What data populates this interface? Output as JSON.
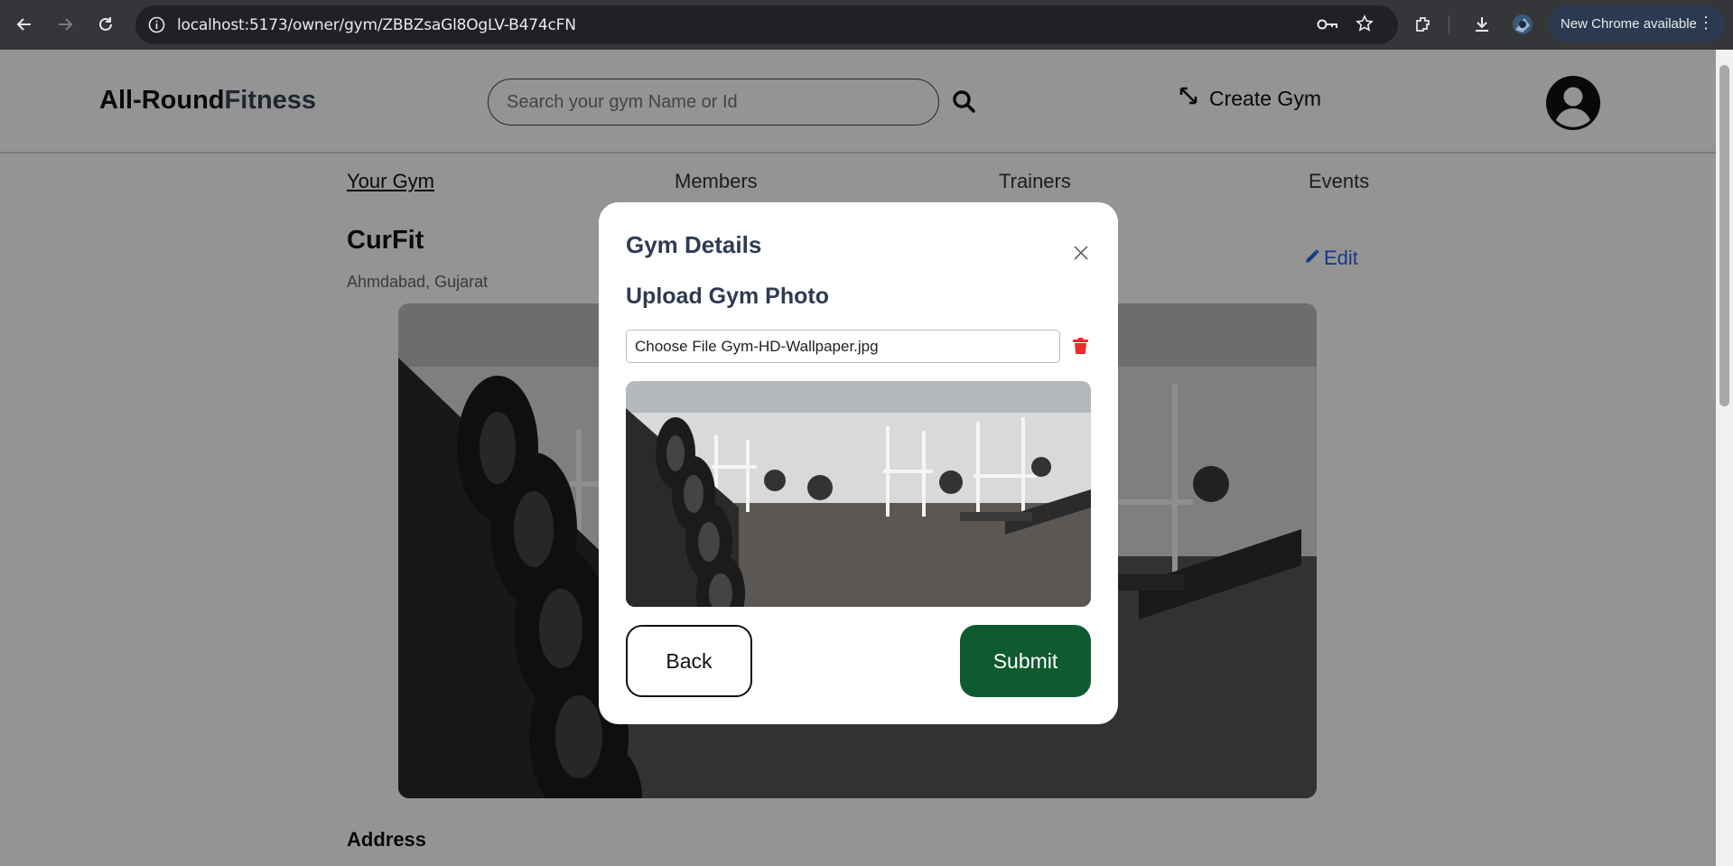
{
  "browser": {
    "url": "localhost:5173/owner/gym/ZBBZsaGl8OgLV-B474cFN",
    "update_label": "New Chrome available",
    "menu_glyph": "⋮"
  },
  "header": {
    "logo_main": "All-Round",
    "logo_accent": "Fitness",
    "search_placeholder": "Search your gym Name or Id",
    "create_label": "Create Gym"
  },
  "nav": {
    "tabs": [
      {
        "label": "Your Gym"
      },
      {
        "label": "Members"
      },
      {
        "label": "Trainers"
      },
      {
        "label": "Events"
      }
    ]
  },
  "gym": {
    "name": "CurFit",
    "location": "Ahmdabad, Gujarat",
    "edit_label": "Edit",
    "section_address": "Address"
  },
  "modal": {
    "title": "Gym Details",
    "subtitle": "Upload Gym Photo",
    "file_button": "Choose File",
    "file_name": "Gym-HD-Wallpaper.jpg",
    "back_label": "Back",
    "submit_label": "Submit"
  },
  "colors": {
    "submit": "#0f5a2f",
    "edit_link": "#2563eb",
    "trash": "#ef2b2b",
    "heading": "#2f3b52"
  },
  "icons": [
    "back-arrow-icon",
    "forward-arrow-icon",
    "reload-icon",
    "site-info-icon",
    "key-icon",
    "star-icon",
    "extensions-icon",
    "download-icon",
    "profile-icon",
    "search-icon",
    "expand-icon",
    "user-circle-icon",
    "pencil-icon",
    "close-icon",
    "trash-icon"
  ]
}
